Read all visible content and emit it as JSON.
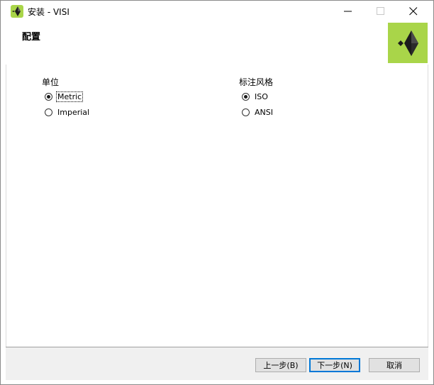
{
  "window": {
    "title": "安装 - VISI"
  },
  "colors": {
    "accent": "#a9d549",
    "focus_border": "#0078d7"
  },
  "header": {
    "title": "配置"
  },
  "units": {
    "label": "单位",
    "options": [
      {
        "label": "Metric",
        "checked": true
      },
      {
        "label": "Imperial",
        "checked": false
      }
    ]
  },
  "dimension_style": {
    "label": "标注风格",
    "options": [
      {
        "label": "ISO",
        "checked": true
      },
      {
        "label": "ANSI",
        "checked": false
      }
    ]
  },
  "footer": {
    "back_label": "上一步(B)",
    "next_label": "下一步(N)",
    "cancel_label": "取消"
  }
}
